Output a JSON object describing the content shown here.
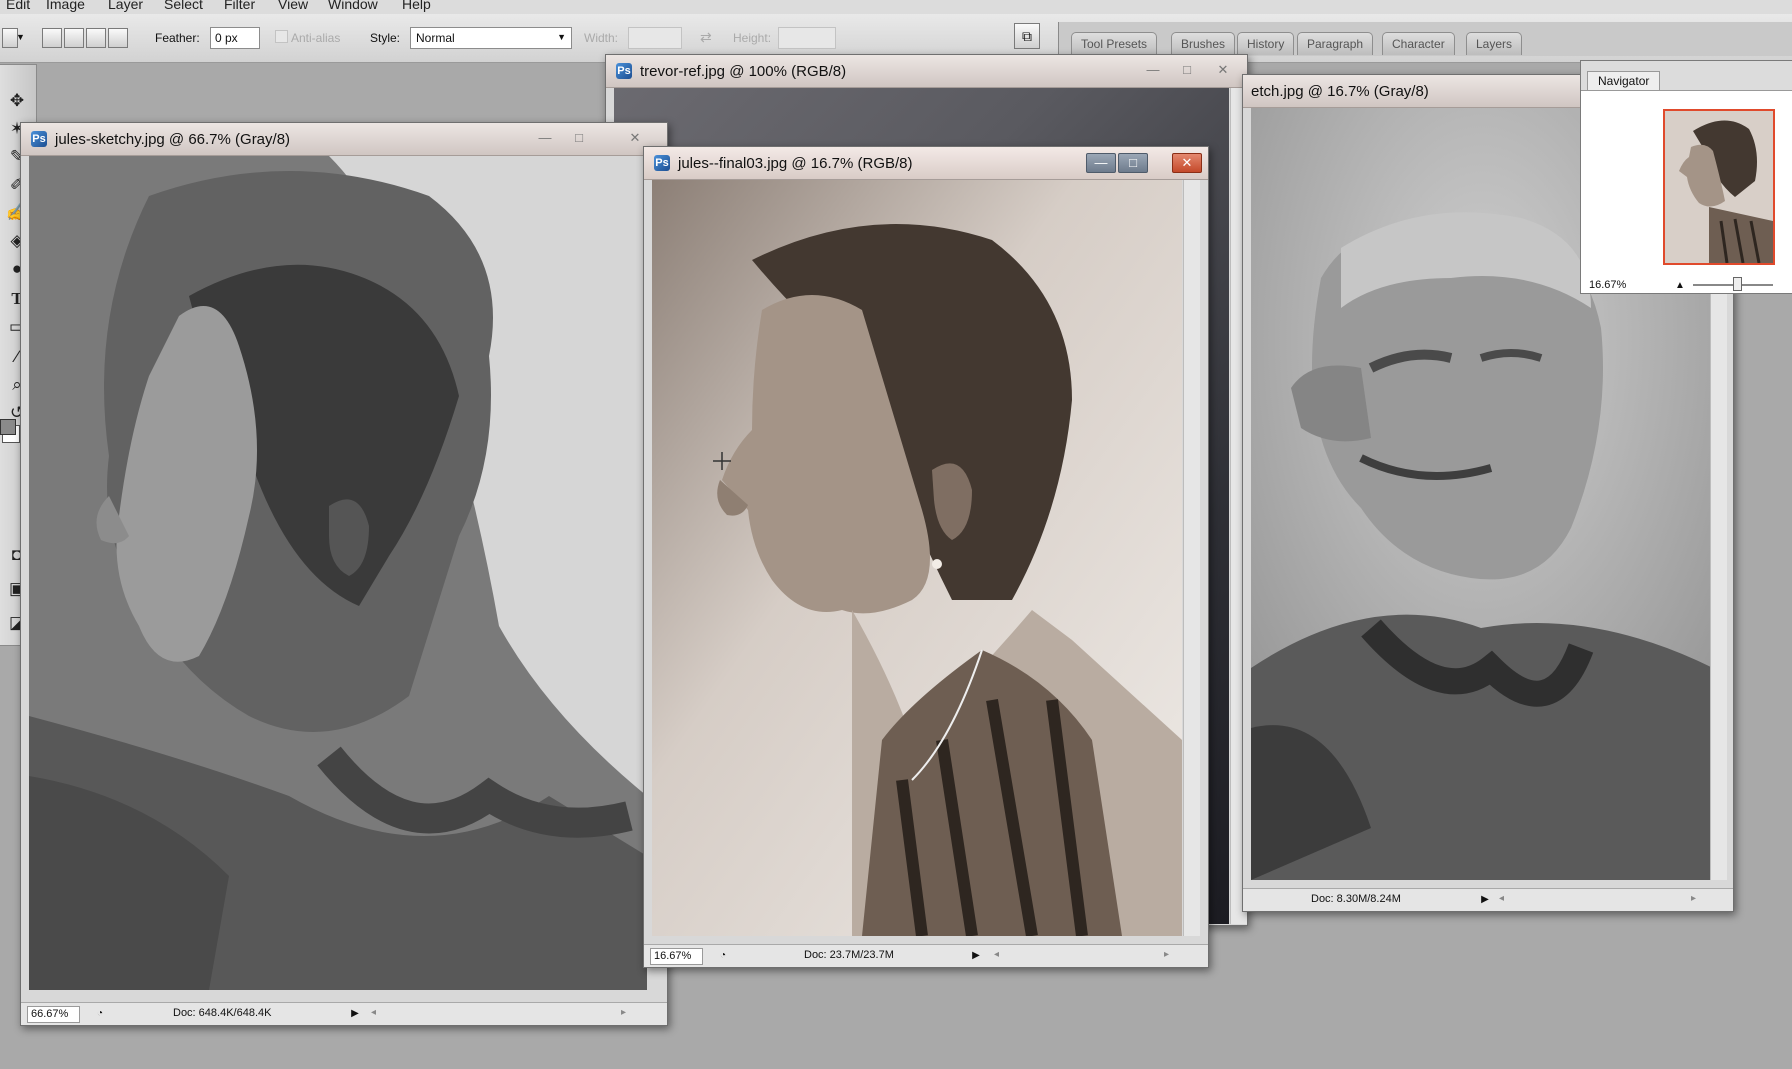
{
  "menu": {
    "items": [
      "Edit",
      "Image",
      "Layer",
      "Select",
      "Filter",
      "View",
      "Window",
      "Help"
    ]
  },
  "options": {
    "feather_label": "Feather:",
    "feather_value": "0 px",
    "antialias_label": "Anti-alias",
    "style_label": "Style:",
    "style_value": "Normal",
    "width_label": "Width:",
    "height_label": "Height:"
  },
  "palette_well": {
    "tabs": [
      "Tool Presets",
      "Brushes",
      "History",
      "Paragraph",
      "Character",
      "Layers"
    ]
  },
  "windows": {
    "sketchy": {
      "title": "jules-sketchy.jpg @ 66.7% (Gray/8)",
      "zoom": "66.67%",
      "doc": "Doc: 648.4K/648.4K"
    },
    "trevor": {
      "title": "trevor-ref.jpg @ 100% (RGB/8)"
    },
    "final": {
      "title": "jules--final03.jpg @ 16.7% (RGB/8)",
      "zoom": "16.67%",
      "doc": "Doc: 23.7M/23.7M"
    },
    "trevor_sketch": {
      "title": "etch.jpg @ 16.7% (Gray/8)",
      "doc": "Doc: 8.30M/8.24M"
    }
  },
  "navigator": {
    "tab": "Navigator",
    "zoom": "16.67%"
  },
  "icons": {
    "ps_doc": "photoshop-document-icon",
    "minimize": "minimize-icon",
    "maximize": "maximize-icon",
    "close": "close-icon"
  }
}
